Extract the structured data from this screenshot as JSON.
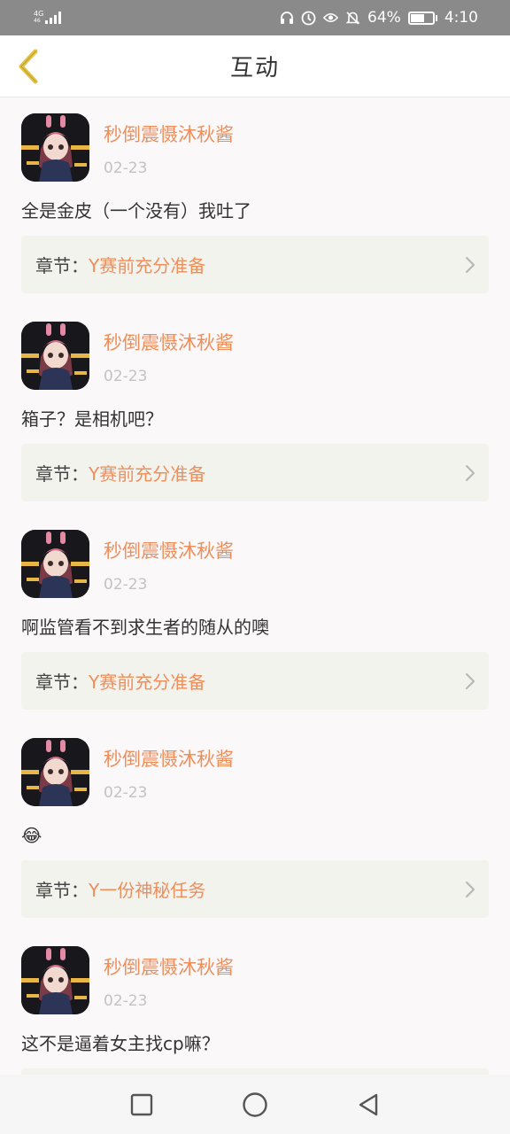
{
  "status_bar": {
    "network_top": "4G",
    "network_bottom": "46",
    "battery_percent": "64%",
    "battery_level": 0.64,
    "time": "4:10",
    "icons": [
      "headset-icon",
      "data-saver-icon",
      "eye-icon",
      "bell-off-icon",
      "battery-icon"
    ]
  },
  "header": {
    "title": "互动",
    "back_icon": "chevron-left-icon"
  },
  "posts": [
    {
      "username": "秒倒震慑沐秋酱",
      "date": "02-23",
      "text": "全是金皮（一个没有）我吐了",
      "chapter_label": "章节：",
      "chapter_name": "Y赛前充分准备"
    },
    {
      "username": "秒倒震慑沐秋酱",
      "date": "02-23",
      "text": "箱子？是相机吧？",
      "chapter_label": "章节：",
      "chapter_name": "Y赛前充分准备"
    },
    {
      "username": "秒倒震慑沐秋酱",
      "date": "02-23",
      "text": "啊监管看不到求生者的随从的噢",
      "chapter_label": "章节：",
      "chapter_name": "Y赛前充分准备"
    },
    {
      "username": "秒倒震慑沐秋酱",
      "date": "02-23",
      "text": "😂",
      "chapter_label": "章节：",
      "chapter_name": "Y一份神秘任务"
    },
    {
      "username": "秒倒震慑沐秋酱",
      "date": "02-23",
      "text": "这不是逼着女主找cp嘛？",
      "chapter_label": "",
      "chapter_name": ""
    }
  ],
  "colors": {
    "accent": "#ee8e5b",
    "back_arrow": "#e2c243",
    "card_bg": "#f3f3ee"
  },
  "nav_bar": {
    "icons": [
      "square-recent-icon",
      "circle-home-icon",
      "triangle-back-icon"
    ]
  }
}
